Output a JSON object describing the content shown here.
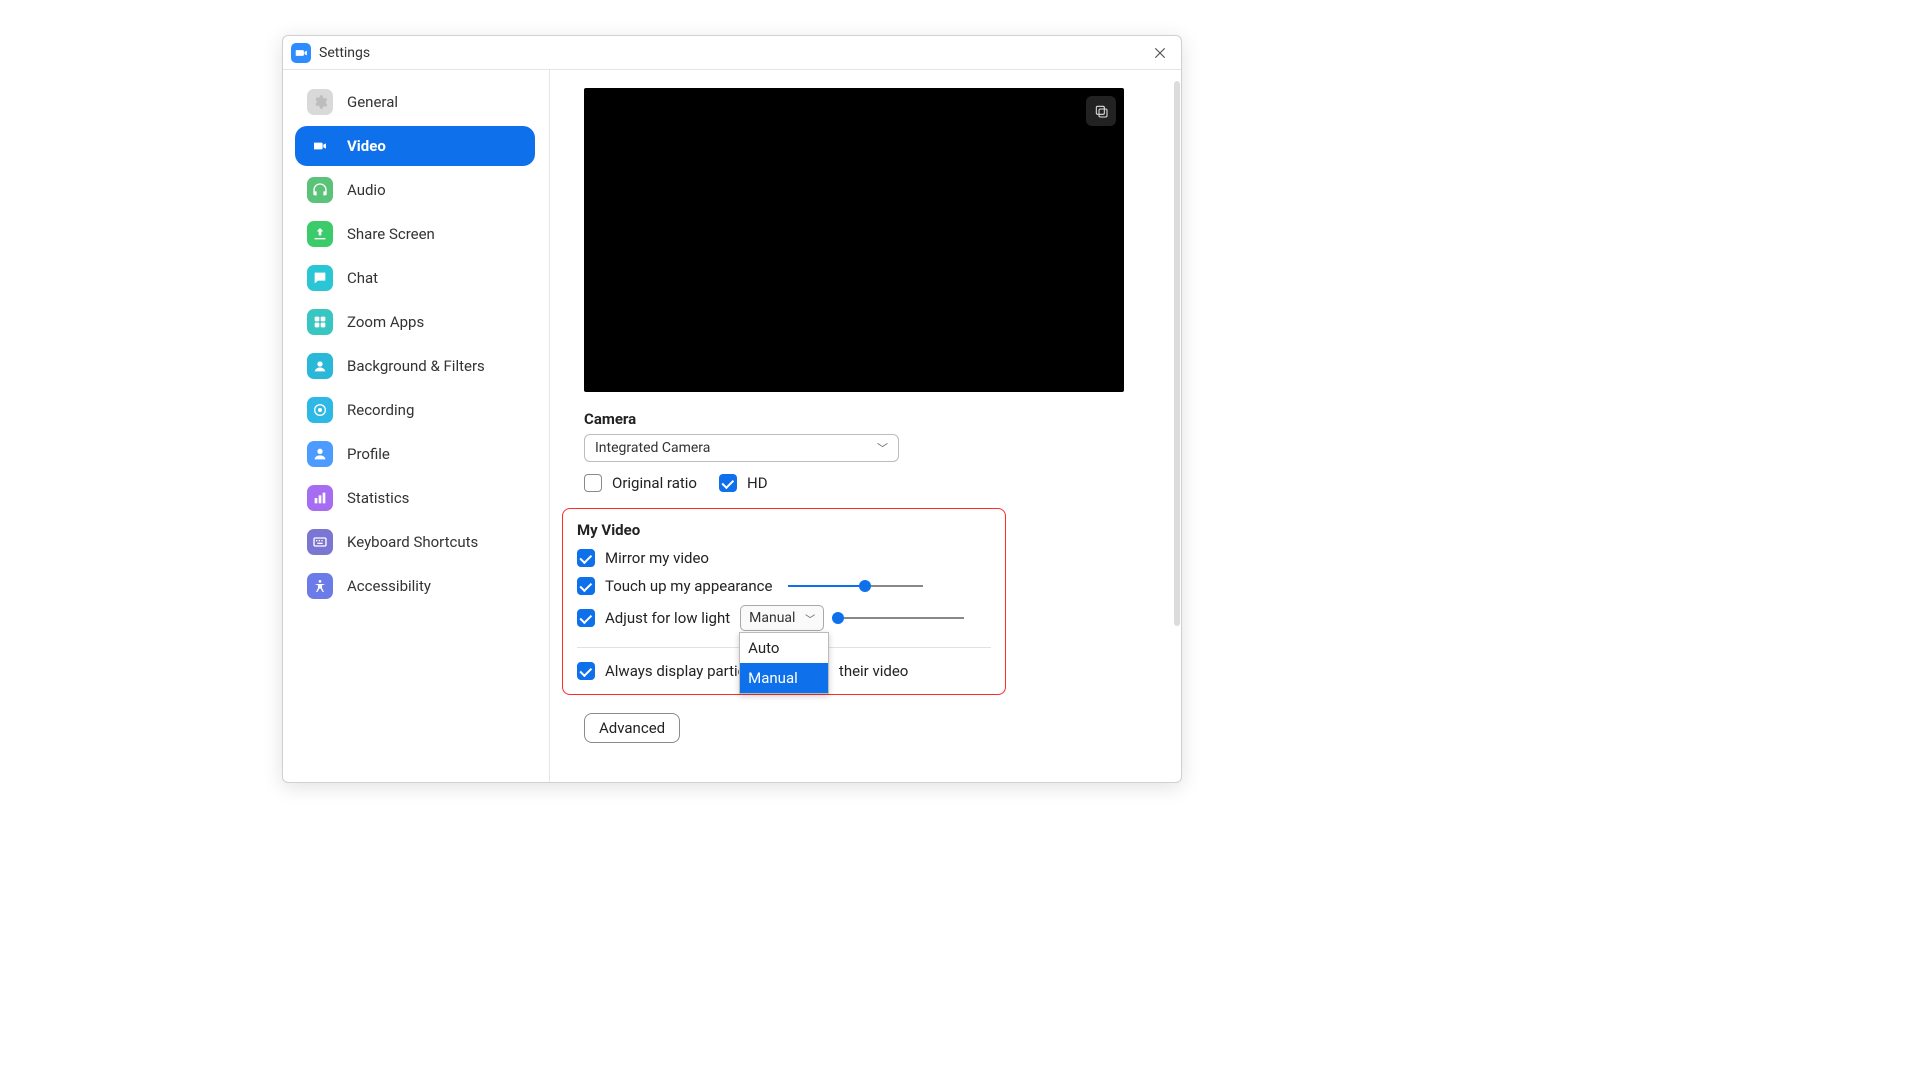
{
  "window": {
    "title": "Settings"
  },
  "sidebar": {
    "items": [
      {
        "label": "General",
        "iconColor": "#d9d9d9",
        "icon": "gear"
      },
      {
        "label": "Video",
        "iconColor": "#0E71EB",
        "icon": "video",
        "active": true
      },
      {
        "label": "Audio",
        "iconColor": "#5BC27A",
        "icon": "headphones"
      },
      {
        "label": "Share Screen",
        "iconColor": "#3BCB6B",
        "icon": "share"
      },
      {
        "label": "Chat",
        "iconColor": "#2AC6D5",
        "icon": "chat"
      },
      {
        "label": "Zoom Apps",
        "iconColor": "#37C6C1",
        "icon": "apps"
      },
      {
        "label": "Background & Filters",
        "iconColor": "#29B8D8",
        "icon": "bgfilters"
      },
      {
        "label": "Recording",
        "iconColor": "#2EB8E6",
        "icon": "record"
      },
      {
        "label": "Profile",
        "iconColor": "#4D9BFF",
        "icon": "profile"
      },
      {
        "label": "Statistics",
        "iconColor": "#A66DF2",
        "icon": "stats"
      },
      {
        "label": "Keyboard Shortcuts",
        "iconColor": "#7B76D3",
        "icon": "keyboard"
      },
      {
        "label": "Accessibility",
        "iconColor": "#6B7CE8",
        "icon": "accessibility"
      }
    ]
  },
  "camera": {
    "heading": "Camera",
    "selected": "Integrated Camera",
    "originalRatio": {
      "label": "Original ratio",
      "checked": false
    },
    "hd": {
      "label": "HD",
      "checked": true
    }
  },
  "myVideo": {
    "heading": "My Video",
    "mirror": {
      "label": "Mirror my video",
      "checked": true
    },
    "touchup": {
      "label": "Touch up my appearance",
      "checked": true,
      "sliderPercent": 57
    },
    "lowlight": {
      "label": "Adjust for low light",
      "checked": true,
      "mode": "Manual",
      "options": [
        "Auto",
        "Manual"
      ],
      "sliderPercent": 3
    },
    "alwaysDisplayPrefix": "Always display partici",
    "alwaysDisplaySuffix": " their video",
    "alwaysDisplayChecked": true
  },
  "advancedButton": "Advanced"
}
